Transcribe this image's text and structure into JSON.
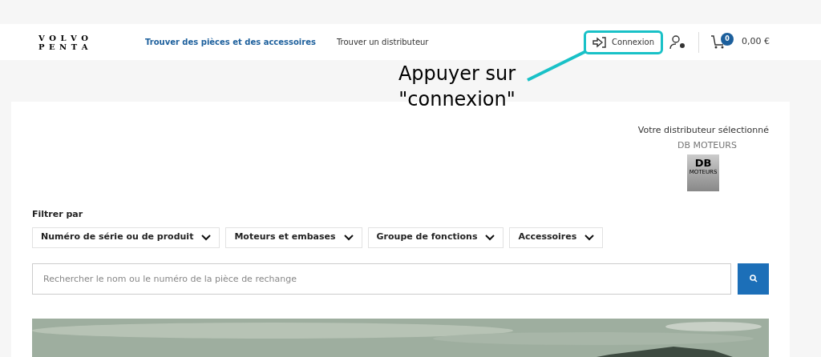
{
  "header": {
    "logo": [
      "V O L V O",
      "P E N T A"
    ],
    "nav": [
      {
        "label": "Trouver des pièces et des accessoires",
        "selected": true
      },
      {
        "label": "Trouver un distributeur",
        "selected": false
      }
    ],
    "login": "Connexion",
    "cart_count": "0",
    "cart_total": "0,00 €"
  },
  "annotation": {
    "text": [
      "Appuyer sur",
      "\"connexion\""
    ]
  },
  "dealer": {
    "title": "Votre distributeur sélectionné",
    "name": "DB MOTEURS",
    "logo": [
      "DB",
      "MOTEURS"
    ]
  },
  "filter": {
    "label": "Filtrer par",
    "dropdowns": [
      "Numéro de série ou de produit",
      "Moteurs et embases",
      "Groupe de fonctions",
      "Accessoires"
    ]
  },
  "search": {
    "placeholder": "Rechercher le nom ou le numéro de la pièce de rechange"
  }
}
